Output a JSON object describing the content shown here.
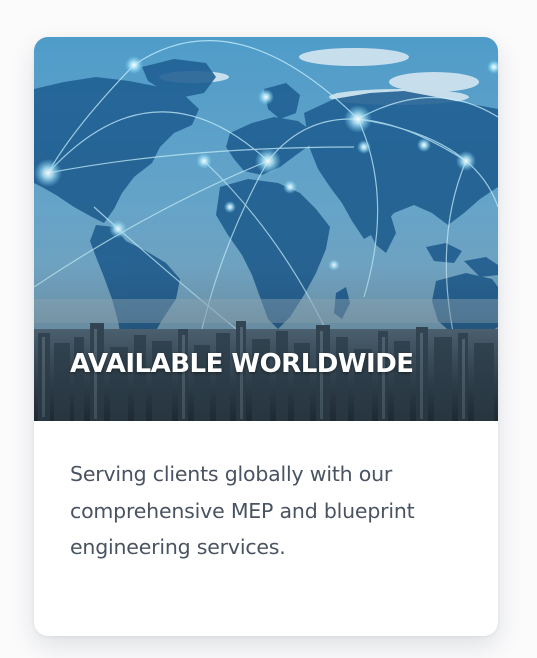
{
  "card": {
    "title": "AVAILABLE WORLDWIDE",
    "description": "Serving clients globally with our comprehensive MEP and blueprint engineering services.",
    "image": {
      "subject": "world-map-network-over-city-skyline"
    }
  },
  "colors": {
    "page_background": "#fbfbfc",
    "card_background": "#ffffff",
    "title_text": "#ffffff",
    "body_text": "#4a5362"
  }
}
